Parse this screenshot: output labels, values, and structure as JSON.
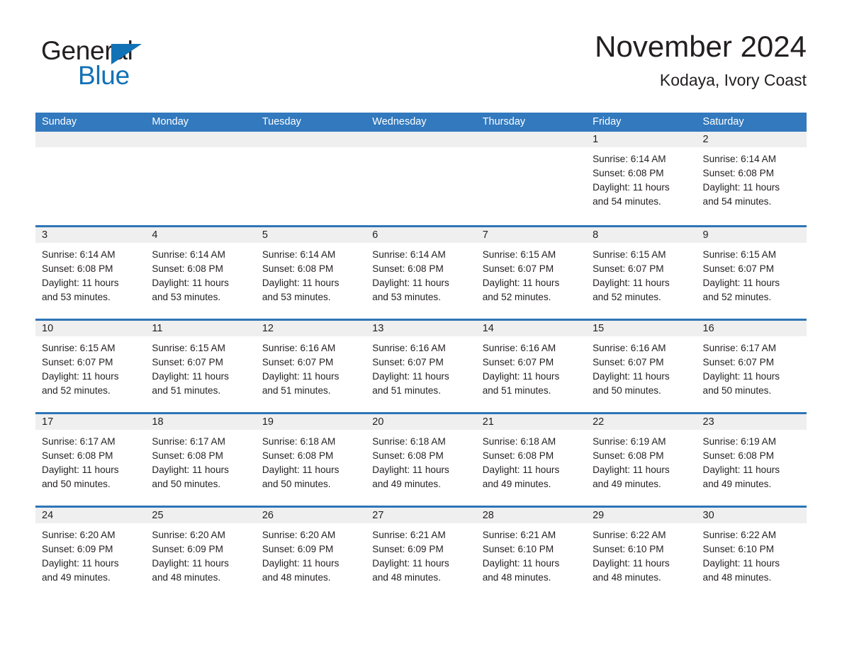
{
  "logo": {
    "word_one": "General",
    "word_two": "Blue",
    "triangle_color": "#1272b6",
    "text_color": "#231f20"
  },
  "header": {
    "title": "November 2024",
    "location": "Kodaya, Ivory Coast"
  },
  "colors": {
    "header_blue": "#3279be",
    "row_separator_blue": "#2e75b6",
    "day_band_gray": "#efefef"
  },
  "weekdays": [
    "Sunday",
    "Monday",
    "Tuesday",
    "Wednesday",
    "Thursday",
    "Friday",
    "Saturday"
  ],
  "weeks": [
    [
      {
        "day": "",
        "lines": []
      },
      {
        "day": "",
        "lines": []
      },
      {
        "day": "",
        "lines": []
      },
      {
        "day": "",
        "lines": []
      },
      {
        "day": "",
        "lines": []
      },
      {
        "day": "1",
        "lines": [
          "Sunrise: 6:14 AM",
          "Sunset: 6:08 PM",
          "Daylight: 11 hours",
          "and 54 minutes."
        ]
      },
      {
        "day": "2",
        "lines": [
          "Sunrise: 6:14 AM",
          "Sunset: 6:08 PM",
          "Daylight: 11 hours",
          "and 54 minutes."
        ]
      }
    ],
    [
      {
        "day": "3",
        "lines": [
          "Sunrise: 6:14 AM",
          "Sunset: 6:08 PM",
          "Daylight: 11 hours",
          "and 53 minutes."
        ]
      },
      {
        "day": "4",
        "lines": [
          "Sunrise: 6:14 AM",
          "Sunset: 6:08 PM",
          "Daylight: 11 hours",
          "and 53 minutes."
        ]
      },
      {
        "day": "5",
        "lines": [
          "Sunrise: 6:14 AM",
          "Sunset: 6:08 PM",
          "Daylight: 11 hours",
          "and 53 minutes."
        ]
      },
      {
        "day": "6",
        "lines": [
          "Sunrise: 6:14 AM",
          "Sunset: 6:08 PM",
          "Daylight: 11 hours",
          "and 53 minutes."
        ]
      },
      {
        "day": "7",
        "lines": [
          "Sunrise: 6:15 AM",
          "Sunset: 6:07 PM",
          "Daylight: 11 hours",
          "and 52 minutes."
        ]
      },
      {
        "day": "8",
        "lines": [
          "Sunrise: 6:15 AM",
          "Sunset: 6:07 PM",
          "Daylight: 11 hours",
          "and 52 minutes."
        ]
      },
      {
        "day": "9",
        "lines": [
          "Sunrise: 6:15 AM",
          "Sunset: 6:07 PM",
          "Daylight: 11 hours",
          "and 52 minutes."
        ]
      }
    ],
    [
      {
        "day": "10",
        "lines": [
          "Sunrise: 6:15 AM",
          "Sunset: 6:07 PM",
          "Daylight: 11 hours",
          "and 52 minutes."
        ]
      },
      {
        "day": "11",
        "lines": [
          "Sunrise: 6:15 AM",
          "Sunset: 6:07 PM",
          "Daylight: 11 hours",
          "and 51 minutes."
        ]
      },
      {
        "day": "12",
        "lines": [
          "Sunrise: 6:16 AM",
          "Sunset: 6:07 PM",
          "Daylight: 11 hours",
          "and 51 minutes."
        ]
      },
      {
        "day": "13",
        "lines": [
          "Sunrise: 6:16 AM",
          "Sunset: 6:07 PM",
          "Daylight: 11 hours",
          "and 51 minutes."
        ]
      },
      {
        "day": "14",
        "lines": [
          "Sunrise: 6:16 AM",
          "Sunset: 6:07 PM",
          "Daylight: 11 hours",
          "and 51 minutes."
        ]
      },
      {
        "day": "15",
        "lines": [
          "Sunrise: 6:16 AM",
          "Sunset: 6:07 PM",
          "Daylight: 11 hours",
          "and 50 minutes."
        ]
      },
      {
        "day": "16",
        "lines": [
          "Sunrise: 6:17 AM",
          "Sunset: 6:07 PM",
          "Daylight: 11 hours",
          "and 50 minutes."
        ]
      }
    ],
    [
      {
        "day": "17",
        "lines": [
          "Sunrise: 6:17 AM",
          "Sunset: 6:08 PM",
          "Daylight: 11 hours",
          "and 50 minutes."
        ]
      },
      {
        "day": "18",
        "lines": [
          "Sunrise: 6:17 AM",
          "Sunset: 6:08 PM",
          "Daylight: 11 hours",
          "and 50 minutes."
        ]
      },
      {
        "day": "19",
        "lines": [
          "Sunrise: 6:18 AM",
          "Sunset: 6:08 PM",
          "Daylight: 11 hours",
          "and 50 minutes."
        ]
      },
      {
        "day": "20",
        "lines": [
          "Sunrise: 6:18 AM",
          "Sunset: 6:08 PM",
          "Daylight: 11 hours",
          "and 49 minutes."
        ]
      },
      {
        "day": "21",
        "lines": [
          "Sunrise: 6:18 AM",
          "Sunset: 6:08 PM",
          "Daylight: 11 hours",
          "and 49 minutes."
        ]
      },
      {
        "day": "22",
        "lines": [
          "Sunrise: 6:19 AM",
          "Sunset: 6:08 PM",
          "Daylight: 11 hours",
          "and 49 minutes."
        ]
      },
      {
        "day": "23",
        "lines": [
          "Sunrise: 6:19 AM",
          "Sunset: 6:08 PM",
          "Daylight: 11 hours",
          "and 49 minutes."
        ]
      }
    ],
    [
      {
        "day": "24",
        "lines": [
          "Sunrise: 6:20 AM",
          "Sunset: 6:09 PM",
          "Daylight: 11 hours",
          "and 49 minutes."
        ]
      },
      {
        "day": "25",
        "lines": [
          "Sunrise: 6:20 AM",
          "Sunset: 6:09 PM",
          "Daylight: 11 hours",
          "and 48 minutes."
        ]
      },
      {
        "day": "26",
        "lines": [
          "Sunrise: 6:20 AM",
          "Sunset: 6:09 PM",
          "Daylight: 11 hours",
          "and 48 minutes."
        ]
      },
      {
        "day": "27",
        "lines": [
          "Sunrise: 6:21 AM",
          "Sunset: 6:09 PM",
          "Daylight: 11 hours",
          "and 48 minutes."
        ]
      },
      {
        "day": "28",
        "lines": [
          "Sunrise: 6:21 AM",
          "Sunset: 6:10 PM",
          "Daylight: 11 hours",
          "and 48 minutes."
        ]
      },
      {
        "day": "29",
        "lines": [
          "Sunrise: 6:22 AM",
          "Sunset: 6:10 PM",
          "Daylight: 11 hours",
          "and 48 minutes."
        ]
      },
      {
        "day": "30",
        "lines": [
          "Sunrise: 6:22 AM",
          "Sunset: 6:10 PM",
          "Daylight: 11 hours",
          "and 48 minutes."
        ]
      }
    ]
  ]
}
